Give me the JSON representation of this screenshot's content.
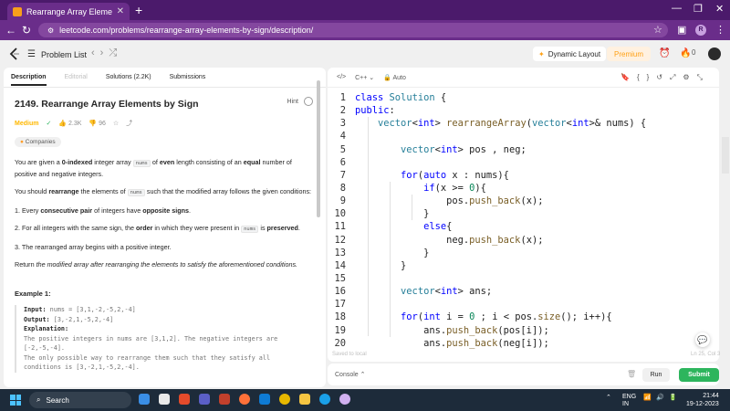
{
  "browser": {
    "tab_title": "Rearrange Array Elements by Si",
    "url": "leetcode.com/problems/rearrange-array-elements-by-sign/description/",
    "profile_initial": "R"
  },
  "topnav": {
    "problem_list": "Problem List",
    "dynamic_layout": "Dynamic Layout",
    "premium": "Premium",
    "streak_count": "0"
  },
  "left_tabs": [
    "Description",
    "Editorial",
    "Solutions (2.2K)",
    "Submissions"
  ],
  "problem": {
    "title": "2149. Rearrange Array Elements by Sign",
    "hint": "Hint",
    "difficulty": "Medium",
    "likes": "2.3K",
    "dislikes": "96",
    "companies": "Companies",
    "desc_1a": "You are given a ",
    "desc_1b": "0-indexed",
    "desc_1c": " integer array ",
    "desc_1d": "nums",
    "desc_1e": " of ",
    "desc_1f": "even",
    "desc_1g": " length consisting of an ",
    "desc_1h": "equal",
    "desc_1i": " number of positive and negative integers.",
    "desc_2a": "You should ",
    "desc_2b": "rearrange",
    "desc_2c": " the elements of ",
    "desc_2d": "nums",
    "desc_2e": " such that the modified array follows the given conditions:",
    "cond_1a": "1. Every ",
    "cond_1b": "consecutive pair",
    "cond_1c": " of integers have ",
    "cond_1d": "opposite signs",
    "cond_1e": ".",
    "cond_2a": "2. For all integers with the same sign, the ",
    "cond_2b": "order",
    "cond_2c": " in which they were present in ",
    "cond_2d": "nums",
    "cond_2e": " is ",
    "cond_2f": "preserved",
    "cond_2g": ".",
    "cond_3": "3. The rearranged array begins with a positive integer.",
    "return_a": "Return ",
    "return_b": "the modified array after rearranging the elements to satisfy the aforementioned conditions.",
    "example_heading": "Example 1:",
    "ex_input_lbl": "Input:",
    "ex_input": " nums = [3,1,-2,-5,2,-4]",
    "ex_output_lbl": "Output:",
    "ex_output": " [3,-2,1,-5,2,-4]",
    "ex_expl_lbl": "Explanation:",
    "ex_expl_1": "The positive integers in nums are [3,1,2]. The negative integers are",
    "ex_expl_2": "[-2,-5,-4].",
    "ex_expl_3": "The only possible way to rearrange them such that they satisfy all",
    "ex_expl_4": "conditions is [3,-2,1,-5,2,-4]."
  },
  "editor": {
    "language": "C++",
    "mode": "Auto",
    "saved": "Saved to local",
    "cursor": "Ln 25, Col 3",
    "lines": [
      {
        "n": "1"
      },
      {
        "n": "2"
      },
      {
        "n": "3"
      },
      {
        "n": "4"
      },
      {
        "n": "5"
      },
      {
        "n": "6"
      },
      {
        "n": "7"
      },
      {
        "n": "8"
      },
      {
        "n": "9"
      },
      {
        "n": "10"
      },
      {
        "n": "11"
      },
      {
        "n": "12"
      },
      {
        "n": "13"
      },
      {
        "n": "14"
      },
      {
        "n": "15"
      },
      {
        "n": "16"
      },
      {
        "n": "17"
      },
      {
        "n": "18"
      },
      {
        "n": "19"
      },
      {
        "n": "20"
      }
    ]
  },
  "console": {
    "label": "Console",
    "run": "Run",
    "submit": "Submit"
  },
  "taskbar": {
    "search": "Search",
    "lang": "ENG",
    "region": "IN",
    "time": "21:44",
    "date": "19-12-2023"
  },
  "colors": {
    "accent_green": "#2db55d",
    "medium": "#ffb800",
    "browser_purple": "#6a2d8a"
  }
}
